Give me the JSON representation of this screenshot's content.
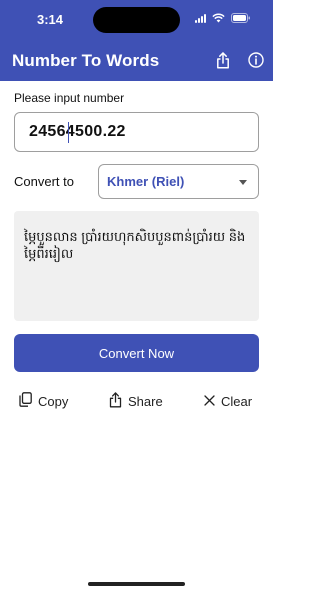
{
  "status_bar": {
    "time": "3:14"
  },
  "nav": {
    "title": "Number To Words",
    "share_icon": "share-icon",
    "info_icon": "info-icon"
  },
  "form": {
    "input_label": "Please input number",
    "number_value": "24564500.22",
    "convert_label": "Convert to",
    "currency_selected": "Khmer (Riel)"
  },
  "result": {
    "text": "ម្ភៃបួនលាន ប្រាំរយហុកសិបបួនពាន់ប្រាំរយ និងម្ភៃពីររៀល"
  },
  "buttons": {
    "convert": "Convert Now",
    "copy": "Copy",
    "share": "Share",
    "clear": "Clear"
  },
  "colors": {
    "accent": "#3f51b5",
    "result_bg": "#f0f0f0"
  }
}
